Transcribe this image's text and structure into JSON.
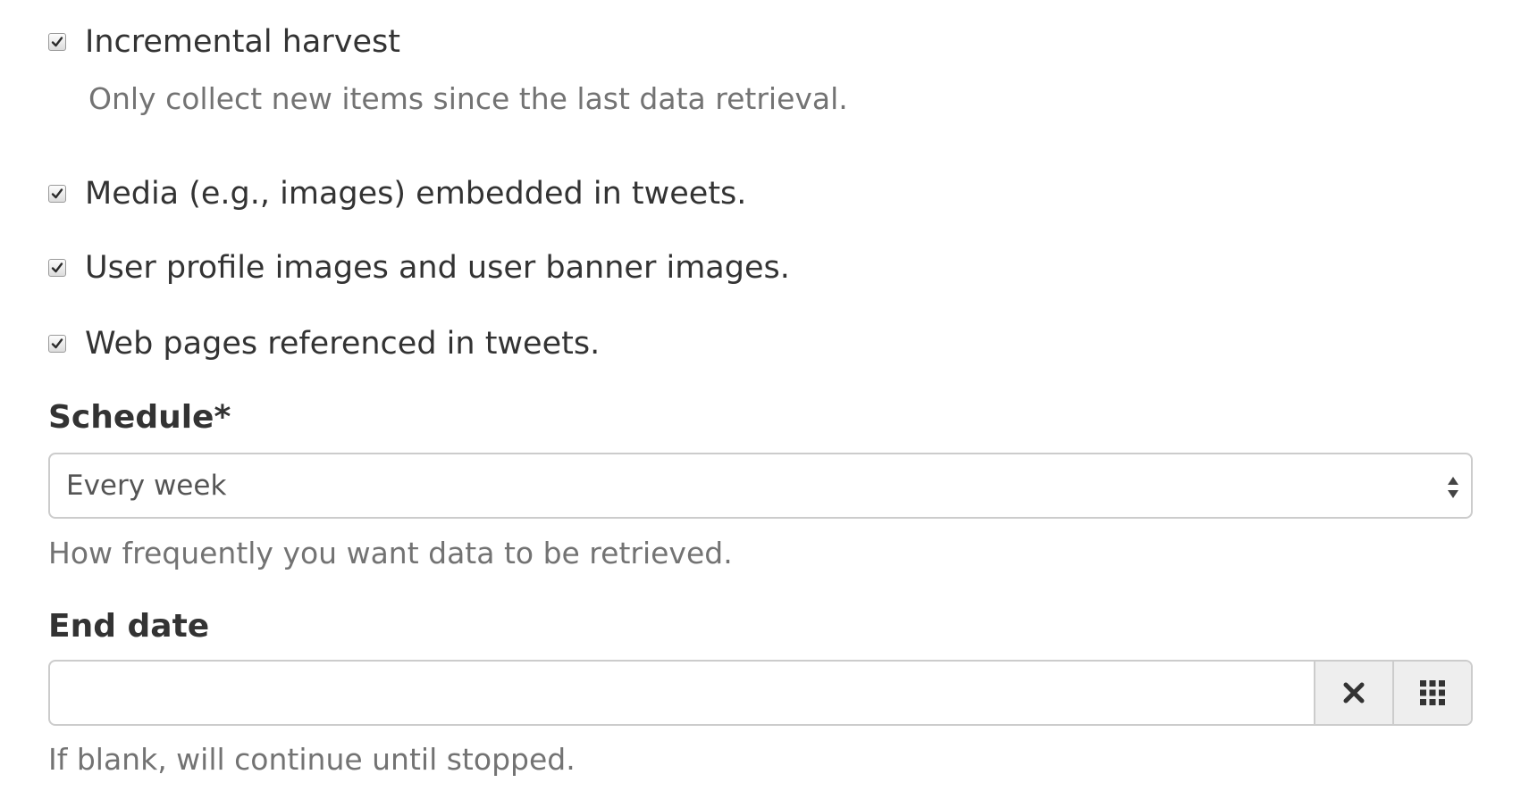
{
  "options": {
    "incremental": {
      "label": "Incremental harvest",
      "checked": true,
      "help": "Only collect new items since the last data retrieval."
    },
    "media": {
      "label": "Media (e.g., images) embedded in tweets.",
      "checked": true
    },
    "user_images": {
      "label": "User profile images and user banner images.",
      "checked": true
    },
    "web_pages": {
      "label": "Web pages referenced in tweets.",
      "checked": true
    }
  },
  "schedule": {
    "label": "Schedule*",
    "selected": "Every week",
    "help": "How frequently you want data to be retrieved."
  },
  "end_date": {
    "label": "End date",
    "value": "",
    "help": "If blank, will continue until stopped.",
    "clear_icon": "times-icon",
    "calendar_icon": "calendar-grid-icon"
  }
}
